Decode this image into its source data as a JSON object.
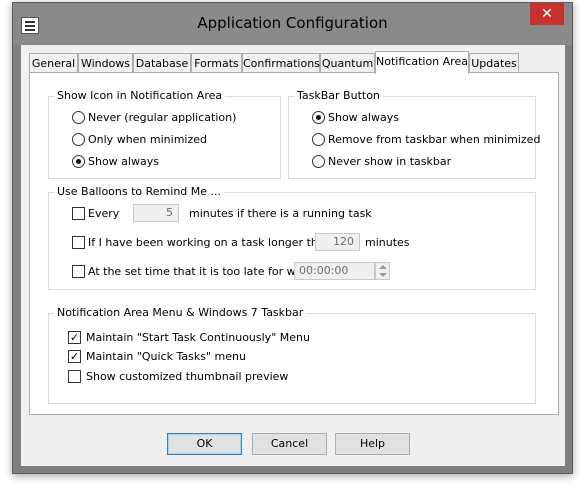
{
  "window": {
    "title": "Application Configuration",
    "close_glyph": "✕",
    "icon": "window-icon"
  },
  "tabs": [
    {
      "label": "General"
    },
    {
      "label": "Windows"
    },
    {
      "label": "Database"
    },
    {
      "label": "Formats"
    },
    {
      "label": "Confirmations"
    },
    {
      "label": "Quantum"
    },
    {
      "label": "Notification Area",
      "active": true
    },
    {
      "label": "Updates"
    }
  ],
  "show_icon": {
    "title": "Show Icon in  Notification Area",
    "options": [
      {
        "label": "Never (regular application)",
        "selected": false
      },
      {
        "label": "Only when minimized",
        "selected": false
      },
      {
        "label": "Show always",
        "selected": true
      }
    ]
  },
  "taskbar": {
    "title": "TaskBar Button",
    "options": [
      {
        "label": "Show always",
        "selected": true
      },
      {
        "label": "Remove from taskbar when minimized",
        "selected": false
      },
      {
        "label": "Never show in taskbar",
        "selected": false
      }
    ]
  },
  "balloons": {
    "title": "Use Balloons to Remind Me ...",
    "every_label": "Every",
    "every_value": "5",
    "every_suffix": "minutes if there is a running task",
    "longer_label": "If I have been working on a task longer than",
    "longer_value": "120",
    "longer_suffix": "minutes",
    "settime_label": "At the set time that it is too late for work",
    "settime_value": "00:00:00"
  },
  "menu": {
    "title": "Notification Area Menu & Windows 7 Taskbar",
    "items": [
      {
        "label": "Maintain \"Start Task Continuously\" Menu",
        "checked": true
      },
      {
        "label": "Maintain \"Quick Tasks\" menu",
        "checked": true
      },
      {
        "label": "Show customized thumbnail preview",
        "checked": false
      }
    ]
  },
  "buttons": {
    "ok": "OK",
    "cancel": "Cancel",
    "help": "Help"
  }
}
